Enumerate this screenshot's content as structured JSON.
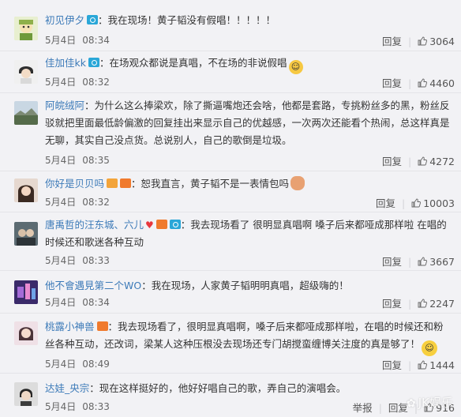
{
  "comments": [
    {
      "username": "初见伊夕",
      "badges": [
        "cam-icon"
      ],
      "text": "：我在现场！黄子韬没有假唱！！！！！",
      "date": "5月4日",
      "time": "08:34",
      "report_label": "",
      "reply_label": "回复",
      "likes": "3064"
    },
    {
      "username": "佳加佳kk",
      "badges": [
        "cam-icon"
      ],
      "text": "：在场观众都说是真唱，不在场的非说假唱",
      "emoji": "smirk-emoji-icon",
      "date": "5月4日",
      "time": "08:32",
      "report_label": "",
      "reply_label": "回复",
      "likes": "4460"
    },
    {
      "username": "阿皖绒阿",
      "badges": [],
      "text": "：为什么这么捧梁欢，除了撕逼嘴炮还会啥，他都是套路，专挑粉丝多的黑，粉丝反驳就把里面最低龄偏激的回复挂出来显示自己的优越感，一次两次还能看个热闹，总这样真是无聊，其实自己没点货。总说别人，自己的歌倒是垃圾。",
      "date": "5月4日",
      "time": "08:35",
      "report_label": "",
      "reply_label": "回复",
      "likes": "4272"
    },
    {
      "username": "你好是贝贝吗",
      "badges": [
        "crown-icon",
        "vip-icon"
      ],
      "text": "：恕我直言，黄子韬不是一表情包吗",
      "emoji": "poop-emoji-icon",
      "date": "5月4日",
      "time": "08:32",
      "report_label": "",
      "reply_label": "回复",
      "likes": "10003"
    },
    {
      "username": "唐禹哲的汪东城、六儿",
      "badges": [
        "heart-icon",
        "vip-icon",
        "cam-icon"
      ],
      "text": "：我去现场看了 很明显真唱啊 嗓子后来都哑成那样啦 在唱的时候还和歌迷各种互动",
      "date": "5月4日",
      "time": "08:33",
      "report_label": "",
      "reply_label": "回复",
      "likes": "3667"
    },
    {
      "username": "他不會遇見第二个WO",
      "badges": [],
      "text": "：我在现场，人家黄子韬明明真唱，超级嗨的！",
      "date": "5月4日",
      "time": "08:34",
      "report_label": "",
      "reply_label": "回复",
      "likes": "2247"
    },
    {
      "username": "桃露小神兽",
      "badges": [
        "vip-icon"
      ],
      "text": "：我去现场看了，很明显真唱啊，嗓子后来都哑成那样啦，在唱的时候还和粉丝各种互动，还改词，梁某人这种压根没去现场还专门胡搅蛮缠博关注度的真是够了！",
      "emoji": "smile-emoji-icon",
      "date": "5月4日",
      "time": "08:49",
      "report_label": "",
      "reply_label": "回复",
      "likes": "1444"
    },
    {
      "username": "达娃_央宗",
      "badges": [],
      "text": "：现在这样挺好的，他好好唱自己的歌，弄自己的演唱会。",
      "date": "5月4日",
      "time": "08:33",
      "report_label": "举报",
      "reply_label": "回复",
      "likes": "916"
    }
  ],
  "watermark": "JK娱乐",
  "colors": {
    "username": "#3c7ab8",
    "background": "#f2f2f5",
    "text": "#333333",
    "meta": "#666666"
  }
}
